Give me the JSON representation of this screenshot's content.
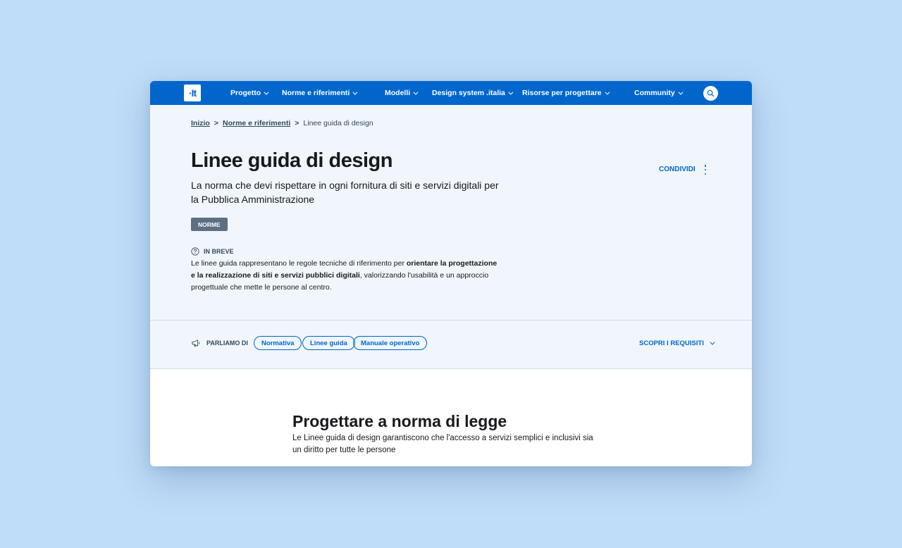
{
  "nav": {
    "logo_text": "·It",
    "items": [
      {
        "label": "Progetto"
      },
      {
        "label": "Norme e riferimenti"
      },
      {
        "label": "Modelli"
      },
      {
        "label": "Design system .italia"
      },
      {
        "label": "Risorse per progettare"
      },
      {
        "label": "Community"
      }
    ],
    "search_icon": "search-icon"
  },
  "breadcrumb": {
    "items": [
      {
        "label": "Inizio"
      },
      {
        "label": "Norme e riferimenti"
      },
      {
        "label": "Linee guida di design"
      }
    ],
    "separator": ">"
  },
  "hero": {
    "title": "Linee guida di design",
    "subtitle": "La norma che devi rispettare in ogni fornitura di siti e servizi digitali per la Pubblica Amministrazione",
    "tag": "NORME",
    "brief_label": "IN BREVE",
    "brief_text_1": "Le linee guida rappresentano le regole tecniche di riferimento per ",
    "brief_text_bold": "orientare la progettazione e la realizzazione di siti e servizi pubblici digitali",
    "brief_text_2": ", valorizzando l'usabilità e un approccio progettuale che mette le persone al centro.",
    "share_label": "CONDIVIDI"
  },
  "topics": {
    "label": "PARLIAMO DI",
    "chips": [
      {
        "label": "Normativa"
      },
      {
        "label": "Linee guida"
      },
      {
        "label": "Manuale operativo"
      }
    ],
    "discover_label": "SCOPRI I REQUISITI"
  },
  "section": {
    "title": "Progettare a norma di legge",
    "text": "Le Linee guida di design garantiscono che l'accesso a servizi semplici e inclusivi sia un diritto per tutte le persone"
  },
  "colors": {
    "primary": "#0066cc",
    "background": "#bfdcf8",
    "hero_bg": "#f0f6fc",
    "tag_bg": "#5d7083"
  }
}
